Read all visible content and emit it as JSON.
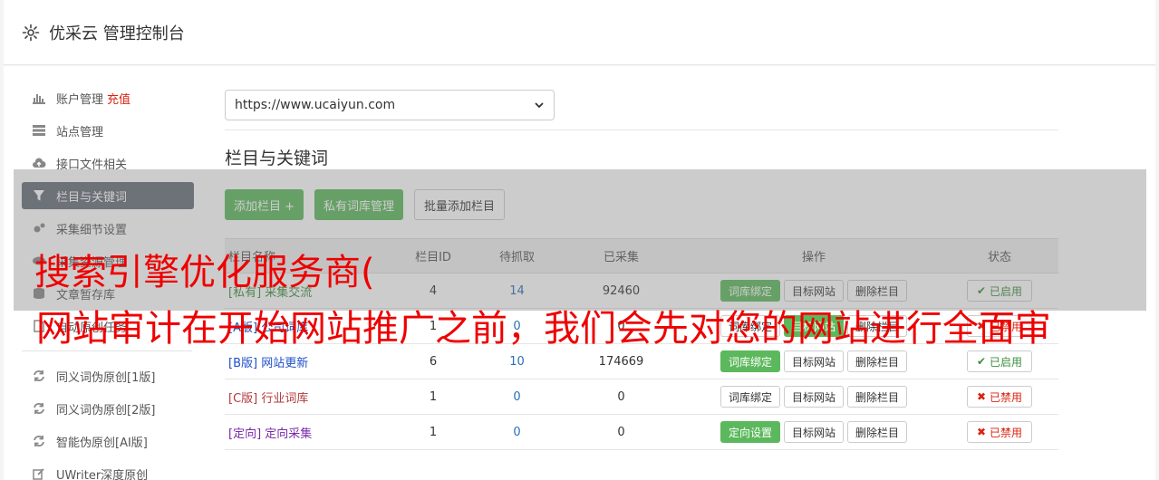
{
  "header": {
    "title": "优采云 管理控制台"
  },
  "sidebar": {
    "items": [
      {
        "label": "账户管理",
        "extra": "充值",
        "icon": "bar-chart-icon"
      },
      {
        "label": "站点管理",
        "icon": "server-icon"
      },
      {
        "label": "接口文件相关",
        "icon": "cloud-upload-icon"
      },
      {
        "label": "栏目与关键词",
        "icon": "filter-icon"
      },
      {
        "label": "采集细节设置",
        "icon": "cogs-icon"
      },
      {
        "label": "采集资源管理",
        "icon": "eye-icon"
      },
      {
        "label": "文章暂存库",
        "icon": "database-icon"
      },
      {
        "label": "自动原创任务",
        "icon": "file-icon"
      }
    ],
    "items2": [
      {
        "label": "同义词伪原创[1版]",
        "icon": "refresh-icon"
      },
      {
        "label": "同义词伪原创[2版]",
        "icon": "refresh-icon"
      },
      {
        "label": "智能伪原创[AI版]",
        "icon": "refresh-icon"
      },
      {
        "label": "UWriter深度原创",
        "icon": "edit-icon"
      }
    ]
  },
  "main": {
    "site_select": "https://www.ucaiyun.com",
    "section_title": "栏目与关键词",
    "buttons": {
      "add": "添加栏目 +",
      "private_lib": "私有词库管理",
      "batch_add": "批量添加栏目"
    },
    "table": {
      "headers": [
        "栏目名称",
        "栏目ID",
        "待抓取",
        "已采集",
        "操作",
        "状态"
      ],
      "rows": [
        {
          "tag": "[私有]",
          "name": "采集交流",
          "id": "4",
          "pending": "14",
          "collected": "92460",
          "op1": "词库绑定",
          "op2": "目标网站",
          "op3": "删除栏目",
          "status": "已启用"
        },
        {
          "tag": "[A版]",
          "name": "公司词库",
          "id": "1",
          "pending": "0",
          "collected": "0",
          "op1": "词库绑定",
          "op2": "目标网站",
          "op3": "删除栏目",
          "status": "已禁用"
        },
        {
          "tag": "[B版]",
          "name": "网站更新",
          "id": "6",
          "pending": "10",
          "collected": "174669",
          "op1": "词库绑定",
          "op2": "目标网站",
          "op3": "删除栏目",
          "status": "已启用"
        },
        {
          "tag": "[C版]",
          "name": "行业词库",
          "id": "1",
          "pending": "0",
          "collected": "0",
          "op1": "词库绑定",
          "op2": "目标网站",
          "op3": "删除栏目",
          "status": "已禁用"
        },
        {
          "tag": "[定向]",
          "name": "定向采集",
          "id": "1",
          "pending": "0",
          "collected": "0",
          "op1": "定向设置",
          "op2": "目标网站",
          "op3": "删除栏目",
          "status": "已禁用"
        }
      ]
    }
  },
  "watermark": {
    "line1": "搜索引擎优化服务商(",
    "line2": "网站审计在开始网站推广之前，我们会先对您的网站进行全面审"
  },
  "colors": {
    "accent": "#5cb85c",
    "active_nav": "#666d78",
    "danger": "#d9230f"
  }
}
